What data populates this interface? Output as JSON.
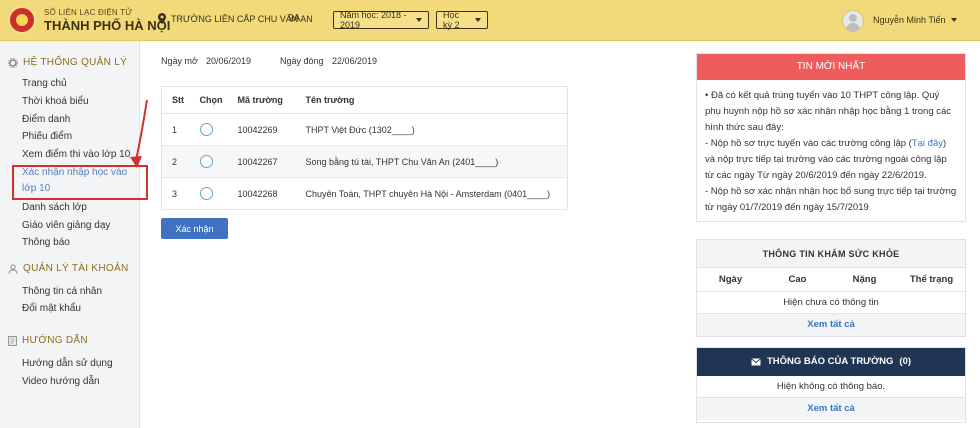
{
  "header": {
    "brand_top": "SỔ LIÊN LẠC ĐIỆN TỬ",
    "brand_main": "THÀNH PHỐ HÀ NỘI",
    "school": "TRƯỜNG LIÊN CẤP CHU VĂN AN",
    "class": "9A",
    "year_select": "Năm học: 2018 - 2019",
    "term_select": "Học kỳ 2",
    "username": "Nguyễn Minh Tiến"
  },
  "sidebar": {
    "management_title": "HỆ THỐNG QUẢN LÝ",
    "management_items": [
      "Trang chủ",
      "Thời khoá biểu",
      "Điểm danh",
      "Phiếu điểm",
      "Xem điểm thi vào lớp 10",
      "Xác nhận nhập học vào lớp 10",
      "Danh sách lớp",
      "Giáo viên giảng dạy",
      "Thông báo"
    ],
    "account_title": "QUẢN LÝ TÀI KHOẢN",
    "account_items": [
      "Thông tin cá nhân",
      "Đổi mật khẩu"
    ],
    "guide_title": "HƯỚNG DẪN",
    "guide_items": [
      "Hướng dẫn sử dụng",
      "Video hướng dẫn"
    ]
  },
  "main": {
    "open_label": "Ngày mở",
    "open_date": "20/06/2019",
    "close_label": "Ngày đóng",
    "close_date": "22/06/2019",
    "columns": [
      "Stt",
      "Chọn",
      "Mã trường",
      "Tên trường"
    ],
    "rows": [
      {
        "stt": "1",
        "code": "10042269",
        "name": "THPT Việt Đức (1302____)"
      },
      {
        "stt": "2",
        "code": "10042267",
        "name": "Song bằng tú tài, THPT Chu Văn An (2401____)"
      },
      {
        "stt": "3",
        "code": "10042268",
        "name": "Chuyên Toán, THPT chuyên Hà Nội - Amsterdam (0401____)"
      }
    ],
    "confirm_label": "Xác nhận"
  },
  "news": {
    "title": "TIN MỚI NHẤT",
    "p1": "• Đã có kết quả trúng tuyển vào 10 THPT công lập. Quý phụ huynh nộp hồ sơ xác nhận nhập học bằng 1 trong các hình thức sau đây:",
    "p2_a": "-     Nộp hồ sơ trực tuyến vào các trường công lập (",
    "p2_link": "Tại đây",
    "p2_b": ") và nộp trực tiếp tại trường vào các trường ngoài công lập từ các ngày Từ ngày 20/6/2019 đến ngày 22/6/2019.",
    "p3": "-     Nộp hồ sơ xác nhận nhận học bổ sung trực tiếp tại trường từ ngày 01/7/2019 đến ngày 15/7/2019"
  },
  "health": {
    "title": "THÔNG TIN KHÁM SỨC KHỎE",
    "columns": [
      "Ngày",
      "Cao",
      "Nặng",
      "Thể trạng"
    ],
    "empty": "Hiện chưa có thông tin",
    "see_all": "Xem tất cả"
  },
  "notify": {
    "title": "THÔNG BÁO CỦA TRƯỜNG",
    "count": "(0)",
    "empty": "Hiện không có thông báo.",
    "see_all": "Xem tất cả"
  },
  "colors": {
    "header_bg": "#f2d97a",
    "news_red": "#ef5c5c",
    "notify_navy": "#1f3553",
    "link_blue": "#3f73c1",
    "highlight_red": "#d0312d"
  }
}
